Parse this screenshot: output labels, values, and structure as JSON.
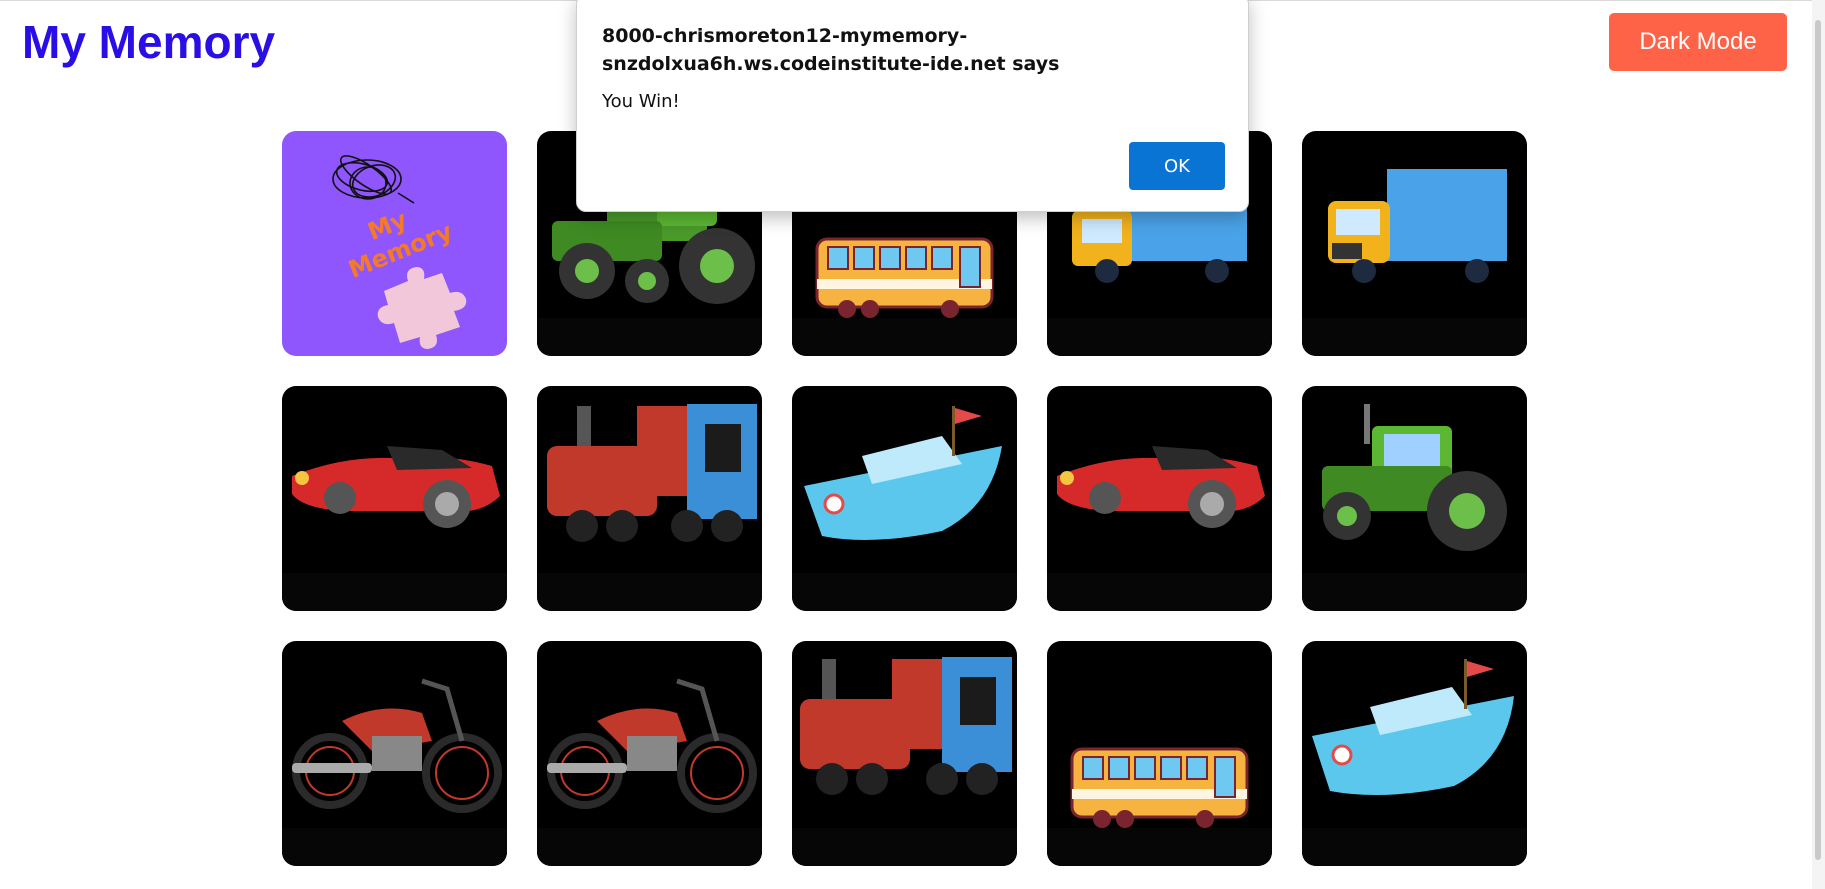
{
  "header": {
    "title": "My Memory",
    "dark_mode_label": "Dark Mode"
  },
  "cards": [
    {
      "image": "card-back-logo",
      "state": "face-down"
    },
    {
      "image": "tractor",
      "state": "face-up"
    },
    {
      "image": "bus",
      "state": "face-up"
    },
    {
      "image": "truck",
      "state": "face-up"
    },
    {
      "image": "truck",
      "state": "face-up"
    },
    {
      "image": "car",
      "state": "face-up"
    },
    {
      "image": "train",
      "state": "face-up"
    },
    {
      "image": "boat",
      "state": "face-up"
    },
    {
      "image": "car",
      "state": "face-up"
    },
    {
      "image": "tractor",
      "state": "face-up"
    },
    {
      "image": "motorcycle",
      "state": "face-up"
    },
    {
      "image": "motorcycle",
      "state": "face-up"
    },
    {
      "image": "train",
      "state": "face-up"
    },
    {
      "image": "bus",
      "state": "face-up"
    },
    {
      "image": "boat",
      "state": "face-up"
    }
  ],
  "card_back": {
    "logo_line1": "My",
    "logo_line2": "Memory"
  },
  "dialog": {
    "title": "8000-chrismoreton12-mymemory-snzdolxua6h.ws.codeinstitute-ide.net says",
    "message": "You Win!",
    "ok_label": "OK"
  },
  "colors": {
    "title": "#2a0ee6",
    "dark_mode_button": "#ff6347",
    "card_back": "#8e56fc",
    "ok_button": "#0a74d4"
  }
}
